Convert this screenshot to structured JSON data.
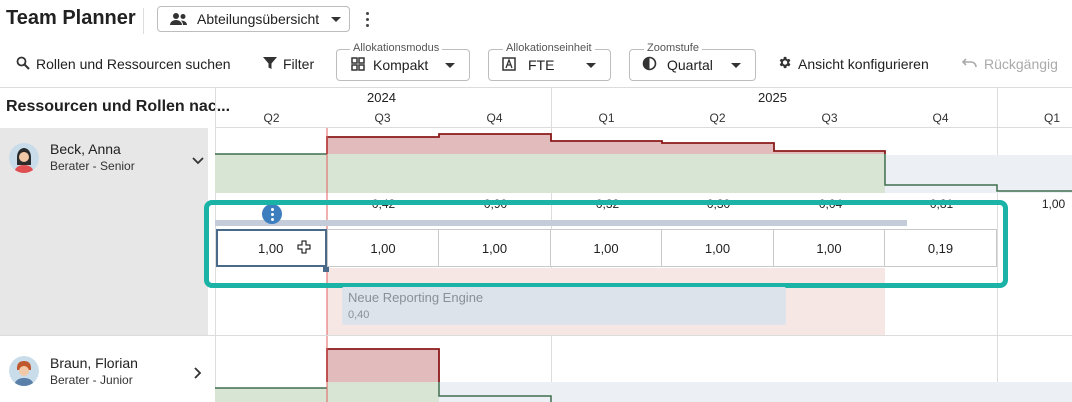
{
  "header": {
    "title": "Team Planner",
    "view_dropdown": "Abteilungsübersicht"
  },
  "toolbar": {
    "search_label": "Rollen und Ressourcen suchen",
    "filter_label": "Filter",
    "allocation_mode": {
      "label": "Allokationsmodus",
      "value": "Kompakt"
    },
    "allocation_unit": {
      "label": "Allokationseinheit",
      "value": "FTE"
    },
    "zoom": {
      "label": "Zoomstufe",
      "value": "Quartal"
    },
    "configure_label": "Ansicht konfigurieren",
    "undo_label": "Rückgängig"
  },
  "timeline": {
    "years": [
      "2024",
      "2025"
    ],
    "quarters": [
      "Q2",
      "Q3",
      "Q4",
      "Q1",
      "Q2",
      "Q3",
      "Q4",
      "Q1"
    ]
  },
  "left_panel": {
    "header": "Ressourcen und Rollen nac..."
  },
  "resources": [
    {
      "name": "Beck, Anna",
      "role": "Berater - Senior",
      "row_values": [
        "",
        "0,42",
        "0,90",
        "0,32",
        "0,30",
        "0,04",
        "0,81",
        "1,00"
      ],
      "allocation_values": [
        "1,00",
        "1,00",
        "1,00",
        "1,00",
        "1,00",
        "1,00",
        "0,19"
      ],
      "project": {
        "name": "Neue Reporting Engine",
        "value": "0,40"
      }
    },
    {
      "name": "Braun, Florian",
      "role": "Berater - Junior"
    }
  ],
  "colors": {
    "accent": "#1ab3a6",
    "overload_fill": "#e2bcbc",
    "overload_line": "#8b1a1a",
    "capacity_fill": "#d9e5d4",
    "capacity_line": "#3f6f4f",
    "project_bar": "#dde3ea",
    "today_line": "#e06060"
  }
}
